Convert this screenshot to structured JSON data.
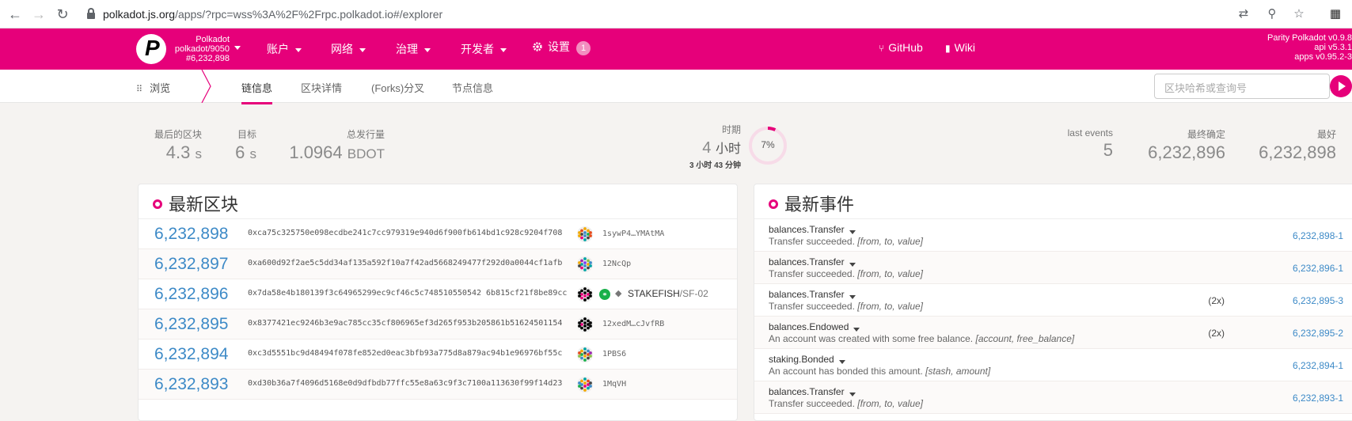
{
  "browser": {
    "url_host": "polkadot.js.org",
    "url_path": "/apps/?rpc=wss%3A%2F%2Frpc.polkadot.io#/explorer"
  },
  "header": {
    "chain_name": "Polkadot",
    "chain_version": "polkadot/9050",
    "chain_block": "#6,232,898",
    "menu": [
      {
        "label": "账户"
      },
      {
        "label": "网络"
      },
      {
        "label": "治理"
      },
      {
        "label": "开发者"
      }
    ],
    "settings_label": "设置",
    "settings_badge": "1",
    "github_label": "GitHub",
    "wiki_label": "Wiki",
    "versions": [
      "Parity Polkadot v0.9.8",
      "api v5.3.1",
      "apps v0.95.2-3"
    ]
  },
  "subnav": {
    "section": "浏览",
    "tabs": [
      {
        "label": "链信息"
      },
      {
        "label": "区块详情"
      },
      {
        "label": "(Forks)分叉"
      },
      {
        "label": "节点信息"
      }
    ],
    "search_placeholder": "区块哈希或查询号"
  },
  "summary": {
    "last_block_label": "最后的区块",
    "last_block_value": "4.3",
    "last_block_unit": "s",
    "target_label": "目标",
    "target_value": "6",
    "target_unit": "s",
    "issuance_label": "总发行量",
    "issuance_value": "1.0964",
    "issuance_unit": "BDOT",
    "era_label": "时期",
    "era_value": "4",
    "era_unit": "小时",
    "era_remaining": "3 小时 43 分钟",
    "era_progress_label": "7%",
    "era_progress": 0.07,
    "last_events_label": "last events",
    "last_events_value": "5",
    "finalized_label": "最终确定",
    "finalized_value": "6,232,896",
    "best_label": "最好",
    "best_value": "6,232,898"
  },
  "blocks": {
    "title": "最新区块",
    "rows": [
      {
        "number": "6,232,898",
        "hash": "0xca75c325750e098ecdbe241c7cc979319e940d6f900fb614bd1c928c9204f708",
        "author": "1sywP4…YMAtMA"
      },
      {
        "number": "6,232,897",
        "hash": "0xa600d92f2ae5c5dd34af135a592f10a7f42ad5668249477f292d0a0044cf1afb",
        "author": "12NcQp"
      },
      {
        "number": "6,232,896",
        "hash": "0x7da58e4b180139f3c64965299ec9cf46c5c748510550542 6b815cf21f8be89cc",
        "author_name": "STAKEFISH",
        "author_sub": "SF-02"
      },
      {
        "number": "6,232,895",
        "hash": "0x8377421ec9246b3e9ac785cc35cf806965ef3d265f953b205861b51624501154",
        "author": "12xedM…cJvfRB"
      },
      {
        "number": "6,232,894",
        "hash": "0xc3d5551bc9d48494f078fe852ed0eac3bfb93a775d8a879ac94b1e96976bf55c",
        "author": "1PBS6"
      },
      {
        "number": "6,232,893",
        "hash": "0xd30b36a7f4096d5168e0d9dfbdb77ffc55e8a63c9f3c7100a113630f99f14d23",
        "author": "1MqVH"
      }
    ]
  },
  "events": {
    "title": "最新事件",
    "rows": [
      {
        "name": "balances.Transfer",
        "desc": "Transfer succeeded.",
        "args": "[from, to, value]",
        "mult": "",
        "ref": "6,232,898-1"
      },
      {
        "name": "balances.Transfer",
        "desc": "Transfer succeeded.",
        "args": "[from, to, value]",
        "mult": "",
        "ref": "6,232,896-1"
      },
      {
        "name": "balances.Transfer",
        "desc": "Transfer succeeded.",
        "args": "[from, to, value]",
        "mult": "(2x)",
        "ref": "6,232,895-3"
      },
      {
        "name": "balances.Endowed",
        "desc": "An account was created with some free balance.",
        "args": "[account, free_balance]",
        "mult": "(2x)",
        "ref": "6,232,895-2"
      },
      {
        "name": "staking.Bonded",
        "desc": "An account has bonded this amount.",
        "args": "[stash, amount]",
        "mult": "",
        "ref": "6,232,894-1"
      },
      {
        "name": "balances.Transfer",
        "desc": "Transfer succeeded.",
        "args": "[from, to, value]",
        "mult": "",
        "ref": "6,232,893-1"
      }
    ]
  },
  "colors": {
    "brand": "#e6007a",
    "link": "#3d8ac7"
  }
}
